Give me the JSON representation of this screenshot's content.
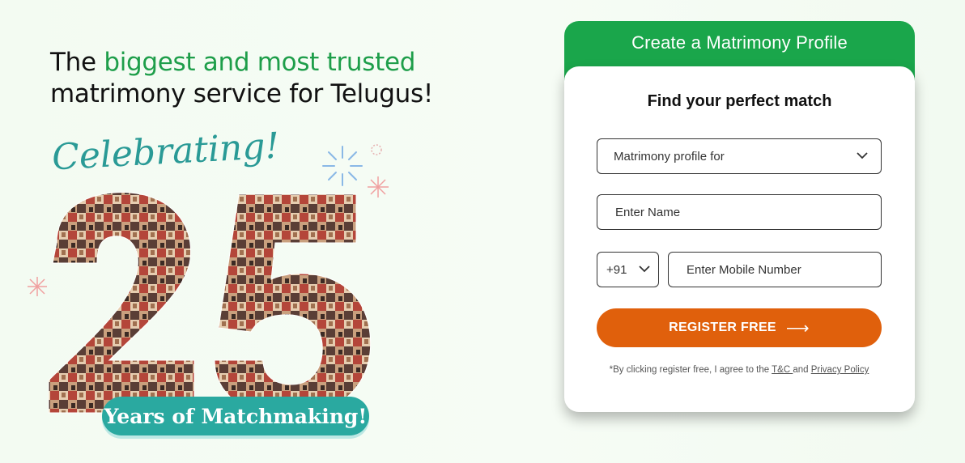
{
  "hero": {
    "headline_prefix": "The ",
    "headline_accent": "biggest and most trusted",
    "headline_line2": "matrimony service for Telugus!",
    "celebrating": "Celebrating!",
    "years_pill": "Years of Matchmaking!"
  },
  "form": {
    "header": "Create a Matrimony Profile",
    "subtitle": "Find your perfect match",
    "profile_for_placeholder": "Matrimony profile for",
    "name_placeholder": "Enter Name",
    "country_code": "+91",
    "mobile_placeholder": "Enter Mobile Number",
    "register_label": "REGISTER FREE",
    "register_arrow": "⟶",
    "terms_prefix": "*By clicking register free, I agree to the ",
    "terms_tc": "T&C ",
    "terms_and": " and ",
    "terms_privacy": "Privacy Policy"
  },
  "colors": {
    "brand_green": "#1aa64b",
    "accent_orange": "#e0600c",
    "teal": "#2aa9a0"
  }
}
